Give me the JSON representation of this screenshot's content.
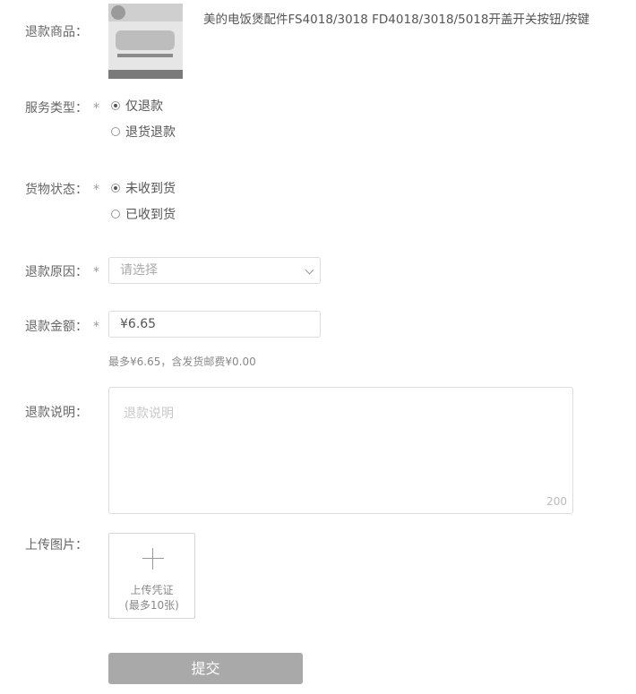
{
  "product": {
    "label": "退款商品：",
    "title": "美的电饭煲配件FS4018/3018 FD4018/3018/5018开盖开关按钮/按键"
  },
  "service_type": {
    "label": "服务类型：",
    "required_mark": "*",
    "options": [
      "仅退款",
      "退货退款"
    ],
    "selected": "仅退款"
  },
  "goods_status": {
    "label": "货物状态：",
    "required_mark": "*",
    "options": [
      "未收到货",
      "已收到货"
    ],
    "selected": "未收到货"
  },
  "reason": {
    "label": "退款原因：",
    "required_mark": "*",
    "placeholder": "请选择"
  },
  "amount": {
    "label": "退款金额：",
    "required_mark": "*",
    "value": "¥6.65",
    "hint": "最多¥6.65，含发货邮费¥0.00"
  },
  "description": {
    "label": "退款说明：",
    "placeholder": "退款说明",
    "max_count": "200"
  },
  "upload": {
    "label": "上传图片：",
    "line1": "上传凭证",
    "line2": "(最多10张)"
  },
  "submit": {
    "label": "提交"
  }
}
